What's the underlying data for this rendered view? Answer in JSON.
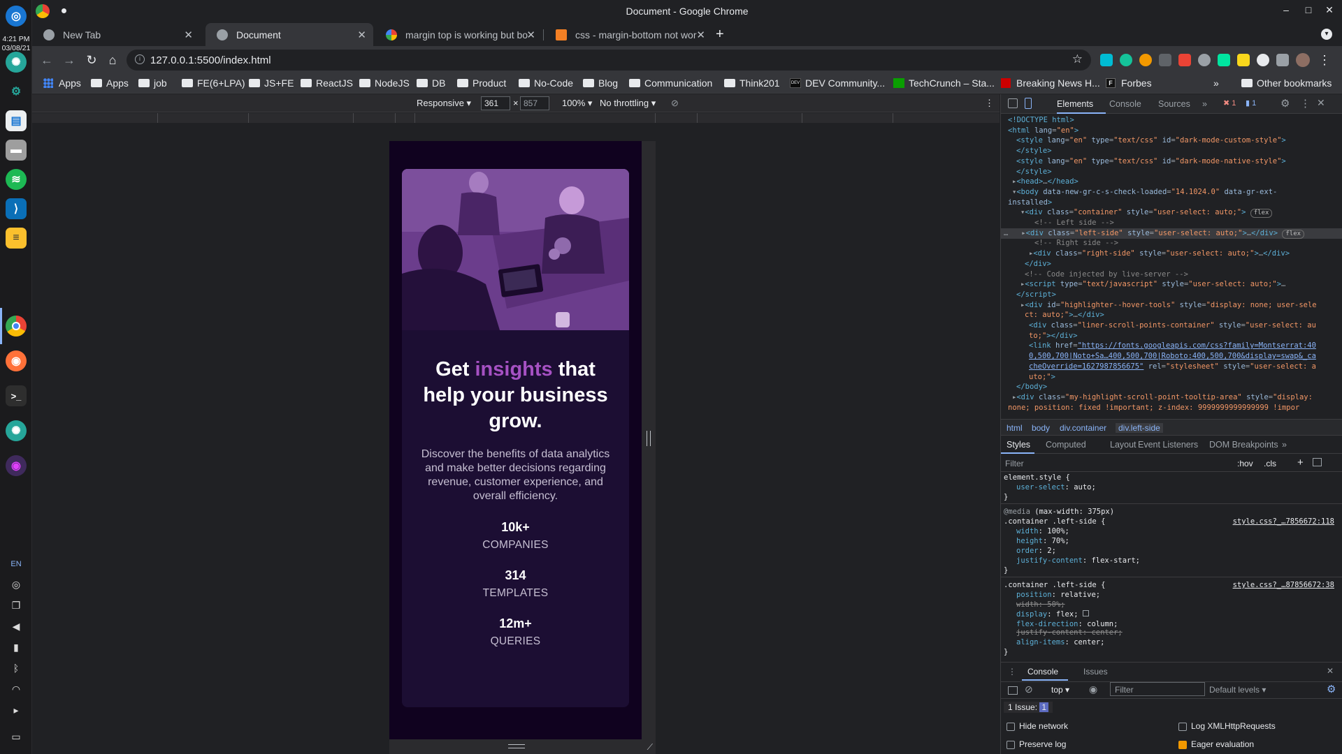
{
  "dock": {
    "time": "4:21 PM",
    "date": "03/08/21",
    "lang": "EN"
  },
  "window": {
    "title": "Document - Google Chrome"
  },
  "tabs": [
    {
      "label": "New Tab",
      "active": false
    },
    {
      "label": "Document",
      "active": true
    },
    {
      "label": "margin top is working but bo",
      "active": false
    },
    {
      "label": "css - margin-bottom not wor",
      "active": false
    }
  ],
  "address": {
    "url": "127.0.0.1:5500/index.html"
  },
  "bookmarks": [
    "Apps",
    "Apps",
    "job",
    "FE(6+LPA)",
    "JS+FE",
    "ReactJS",
    "NodeJS",
    "DB",
    "Product",
    "No-Code",
    "Blog",
    "Communication",
    "Think201",
    "DEV Community...",
    "TechCrunch – Sta...",
    "Breaking News H...",
    "Forbes"
  ],
  "bookmarks_more": "»",
  "bookmarks_other": "Other bookmarks",
  "device_toolbar": {
    "mode": "Responsive ▾",
    "width": "361",
    "times": "×",
    "height": "857",
    "zoom": "100% ▾",
    "throttle": "No throttling ▾"
  },
  "card": {
    "title_pre": "Get ",
    "title_accent": "insights",
    "title_post": " that help your business grow.",
    "description": "Discover the benefits of data analytics and make better decisions regarding revenue, customer experience, and overall efficiency.",
    "stats": [
      {
        "value": "10k+",
        "label": "COMPANIES"
      },
      {
        "value": "314",
        "label": "TEMPLATES"
      },
      {
        "value": "12m+",
        "label": "QUERIES"
      }
    ]
  },
  "devtools": {
    "tabs": [
      "Elements",
      "Console",
      "Sources",
      "»"
    ],
    "errors": "1",
    "issues": "1",
    "breadcrumbs": [
      "html",
      "body",
      "div.container",
      "div.left-side"
    ],
    "style_tabs": [
      "Styles",
      "Computed",
      "Layout",
      "Event Listeners",
      "DOM Breakpoints",
      "»"
    ],
    "filter_placeholder": "Filter",
    "hov": ":hov",
    "cls": ".cls",
    "source1": "style.css?_…7856672:118",
    "source2": "style.css?_…87856672:38",
    "console_tabs": [
      "Console",
      "Issues"
    ],
    "context": "top ▾",
    "console_filter": "Filter",
    "levels": "Default levels ▾",
    "issue_count": "1 Issue:",
    "issue_badge": "1",
    "checks": [
      {
        "label": "Hide network",
        "checked": false
      },
      {
        "label": "Log XMLHttpRequests",
        "checked": false
      },
      {
        "label": "Preserve log",
        "checked": false
      },
      {
        "label": "Eager evaluation",
        "checked": true
      }
    ]
  },
  "colors": {
    "accent": "#a651c3",
    "card_bg": "#1c0e33",
    "page_bg": "#10021f"
  }
}
